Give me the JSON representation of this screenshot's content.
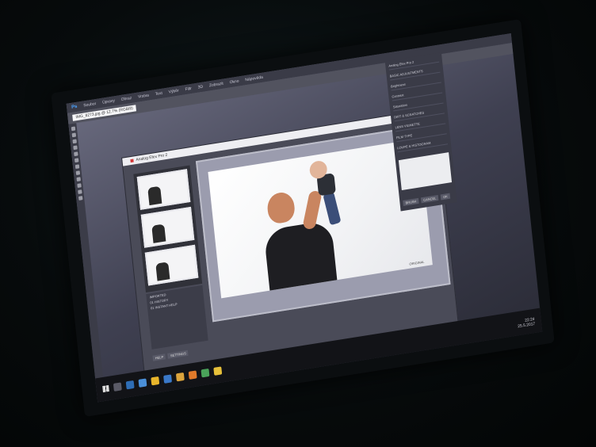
{
  "menubar": {
    "logo": "Ps",
    "items": [
      "Soubor",
      "Úpravy",
      "Obraz",
      "Vrstva",
      "Text",
      "Výběr",
      "Filtr",
      "3D",
      "Zobrazit",
      "Okno",
      "Nápověda"
    ]
  },
  "options": {
    "document_tab": "IMG_8273.jpg @ 12,7% (RGB/8)"
  },
  "plugin": {
    "title": "Analog Efex Pro 2",
    "history_header": "IMPORTED",
    "history_items": [
      "01 HISTORY",
      "01 INSTANT HELP"
    ],
    "help_buttons": [
      "HELP",
      "SETTINGS"
    ],
    "photo_caption": "ORIGINAL"
  },
  "right_panel": {
    "title": "Analog Efex Pro 2",
    "rows": [
      "BASIC ADJUSTMENTS",
      "Brightness",
      "Contrast",
      "Saturation",
      "DIRT & SCRATCHES",
      "LENS VIGNETTE",
      "FILM TYPE",
      "LOUPE & HISTOGRAM"
    ],
    "buttons": [
      "BRUSH",
      "CANCEL",
      "OK"
    ]
  },
  "tray": {
    "time": "22:24",
    "date": "25.5.2017"
  },
  "colors": {
    "screen": "#4a4b58",
    "accent": "#d43b3b",
    "ps_blue": "#4aa3ff"
  }
}
